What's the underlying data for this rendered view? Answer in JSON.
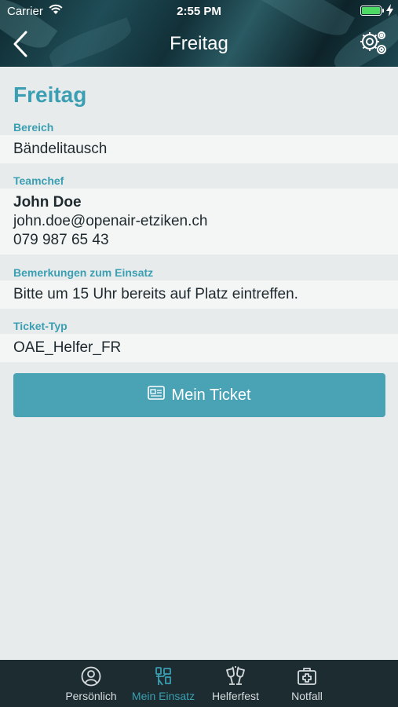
{
  "status_bar": {
    "carrier": "Carrier",
    "time": "2:55 PM",
    "battery_level": 1.0
  },
  "nav": {
    "title": "Freitag",
    "back_icon": "chevron-left-icon",
    "settings_icon": "gears-icon"
  },
  "page": {
    "title": "Freitag",
    "sections": {
      "bereich": {
        "label": "Bereich",
        "value": "Bändelitausch"
      },
      "teamchef": {
        "label": "Teamchef",
        "name": "John Doe",
        "email": "john.doe@openair-etziken.ch",
        "phone": "079 987 65 43"
      },
      "bemerkungen": {
        "label": "Bemerkungen zum Einsatz",
        "value": "Bitte um 15 Uhr bereits auf Platz eintreffen."
      },
      "ticket_typ": {
        "label": "Ticket-Typ",
        "value": "OAE_Helfer_FR"
      }
    },
    "ticket_button": {
      "label": "Mein Ticket",
      "icon": "ticket-icon"
    }
  },
  "tabbar": {
    "active": "mein_einsatz",
    "items": [
      {
        "key": "persoenlich",
        "label": "Persönlich",
        "icon": "user-circle-icon"
      },
      {
        "key": "mein_einsatz",
        "label": "Mein Einsatz",
        "icon": "helper-icon"
      },
      {
        "key": "helferfest",
        "label": "Helferfest",
        "icon": "cheers-glasses-icon"
      },
      {
        "key": "notfall",
        "label": "Notfall",
        "icon": "first-aid-kit-icon"
      }
    ]
  },
  "colors": {
    "accent": "#3a9fb3",
    "button": "#4aa2b5",
    "tabbar": "#1d2c30",
    "background": "#e8ebeb"
  }
}
